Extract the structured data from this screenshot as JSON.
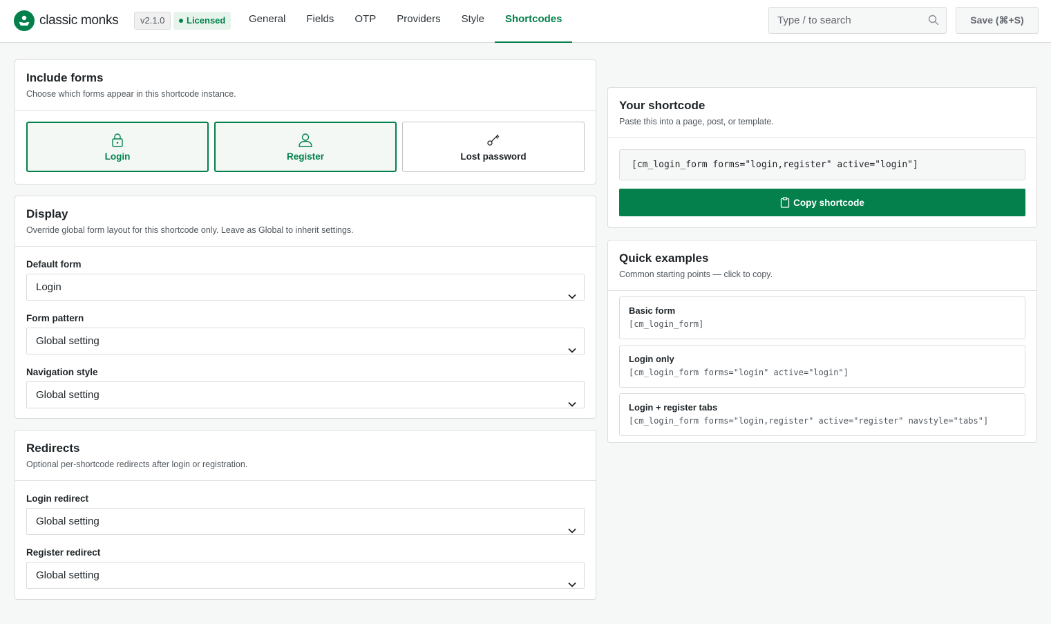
{
  "header": {
    "brand": "classic monks",
    "version": "v2.1.0",
    "license_status": "Licensed",
    "tabs": [
      {
        "label": "General"
      },
      {
        "label": "Fields"
      },
      {
        "label": "OTP"
      },
      {
        "label": "Providers"
      },
      {
        "label": "Style"
      },
      {
        "label": "Shortcodes"
      }
    ],
    "active_tab": "Shortcodes",
    "search_placeholder": "Type / to search",
    "save_label": "Save (⌘+S)"
  },
  "include_forms": {
    "title": "Include forms",
    "subtitle": "Choose which forms appear in this shortcode instance.",
    "options": [
      {
        "label": "Login",
        "icon": "lock-icon",
        "selected": true
      },
      {
        "label": "Register",
        "icon": "user-icon",
        "selected": true
      },
      {
        "label": "Lost password",
        "icon": "key-icon",
        "selected": false
      }
    ]
  },
  "display": {
    "title": "Display",
    "subtitle": "Override global form layout for this shortcode only. Leave as Global to inherit settings.",
    "fields": [
      {
        "label": "Default form",
        "value": "Login"
      },
      {
        "label": "Form pattern",
        "value": "Global setting"
      },
      {
        "label": "Navigation style",
        "value": "Global setting"
      }
    ]
  },
  "redirects": {
    "title": "Redirects",
    "subtitle": "Optional per-shortcode redirects after login or registration.",
    "fields": [
      {
        "label": "Login redirect",
        "value": "Global setting"
      },
      {
        "label": "Register redirect",
        "value": "Global setting"
      }
    ]
  },
  "your_shortcode": {
    "title": "Your shortcode",
    "subtitle": "Paste this into a page, post, or template.",
    "code": "[cm_login_form forms=\"login,register\" active=\"login\"]",
    "copy_label": "Copy shortcode"
  },
  "quick_examples": {
    "title": "Quick examples",
    "subtitle": "Common starting points — click to copy.",
    "items": [
      {
        "title": "Basic form",
        "code": "[cm_login_form]"
      },
      {
        "title": "Login only",
        "code": "[cm_login_form forms=\"login\" active=\"login\"]"
      },
      {
        "title": "Login + register tabs",
        "code": "[cm_login_form forms=\"login,register\" active=\"register\" navstyle=\"tabs\"]"
      }
    ]
  },
  "colors": {
    "accent": "#03804b",
    "accent_tint": "#f3f8f5",
    "border": "#dcdcde",
    "background": "#f6f7f7"
  }
}
